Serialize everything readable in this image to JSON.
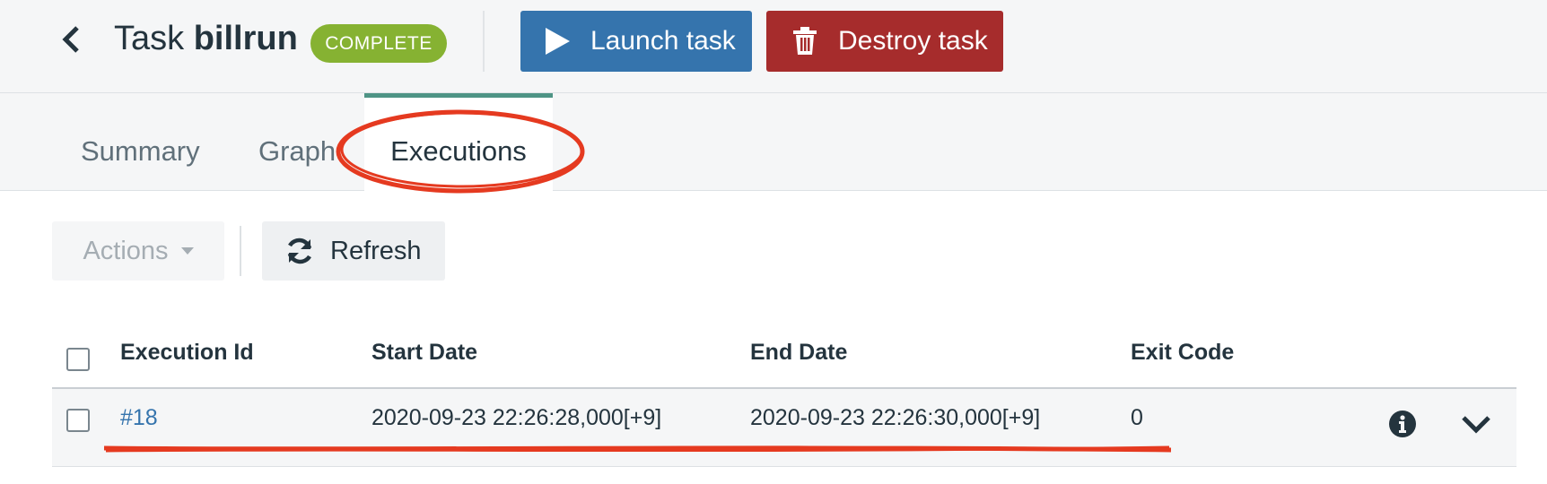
{
  "header": {
    "back_icon": "chevron-left-icon",
    "title_prefix": "Task",
    "title_name": "billrun",
    "status_badge": "COMPLETE",
    "launch_label": "Launch task",
    "launch_icon": "play-icon",
    "destroy_label": "Destroy task",
    "destroy_icon": "trash-icon"
  },
  "tabs": [
    {
      "label": "Summary",
      "active": false
    },
    {
      "label": "Graph",
      "active": false
    },
    {
      "label": "Executions",
      "active": true
    }
  ],
  "toolbar": {
    "actions_label": "Actions",
    "refresh_label": "Refresh",
    "refresh_icon": "refresh-icon"
  },
  "table": {
    "columns": [
      "Execution Id",
      "Start Date",
      "End Date",
      "Exit Code"
    ],
    "rows": [
      {
        "execution_id": "#18",
        "start_date": "2020-09-23 22:26:28,000[+9]",
        "end_date": "2020-09-23 22:26:30,000[+9]",
        "exit_code": "0",
        "info_icon": "info-icon",
        "expand_icon": "chevron-down-icon"
      }
    ]
  },
  "colors": {
    "primary": "#3574ad",
    "danger": "#a62c2c",
    "success": "#86b232",
    "tab_accent": "#4e9485",
    "annotation": "#e53a20"
  }
}
